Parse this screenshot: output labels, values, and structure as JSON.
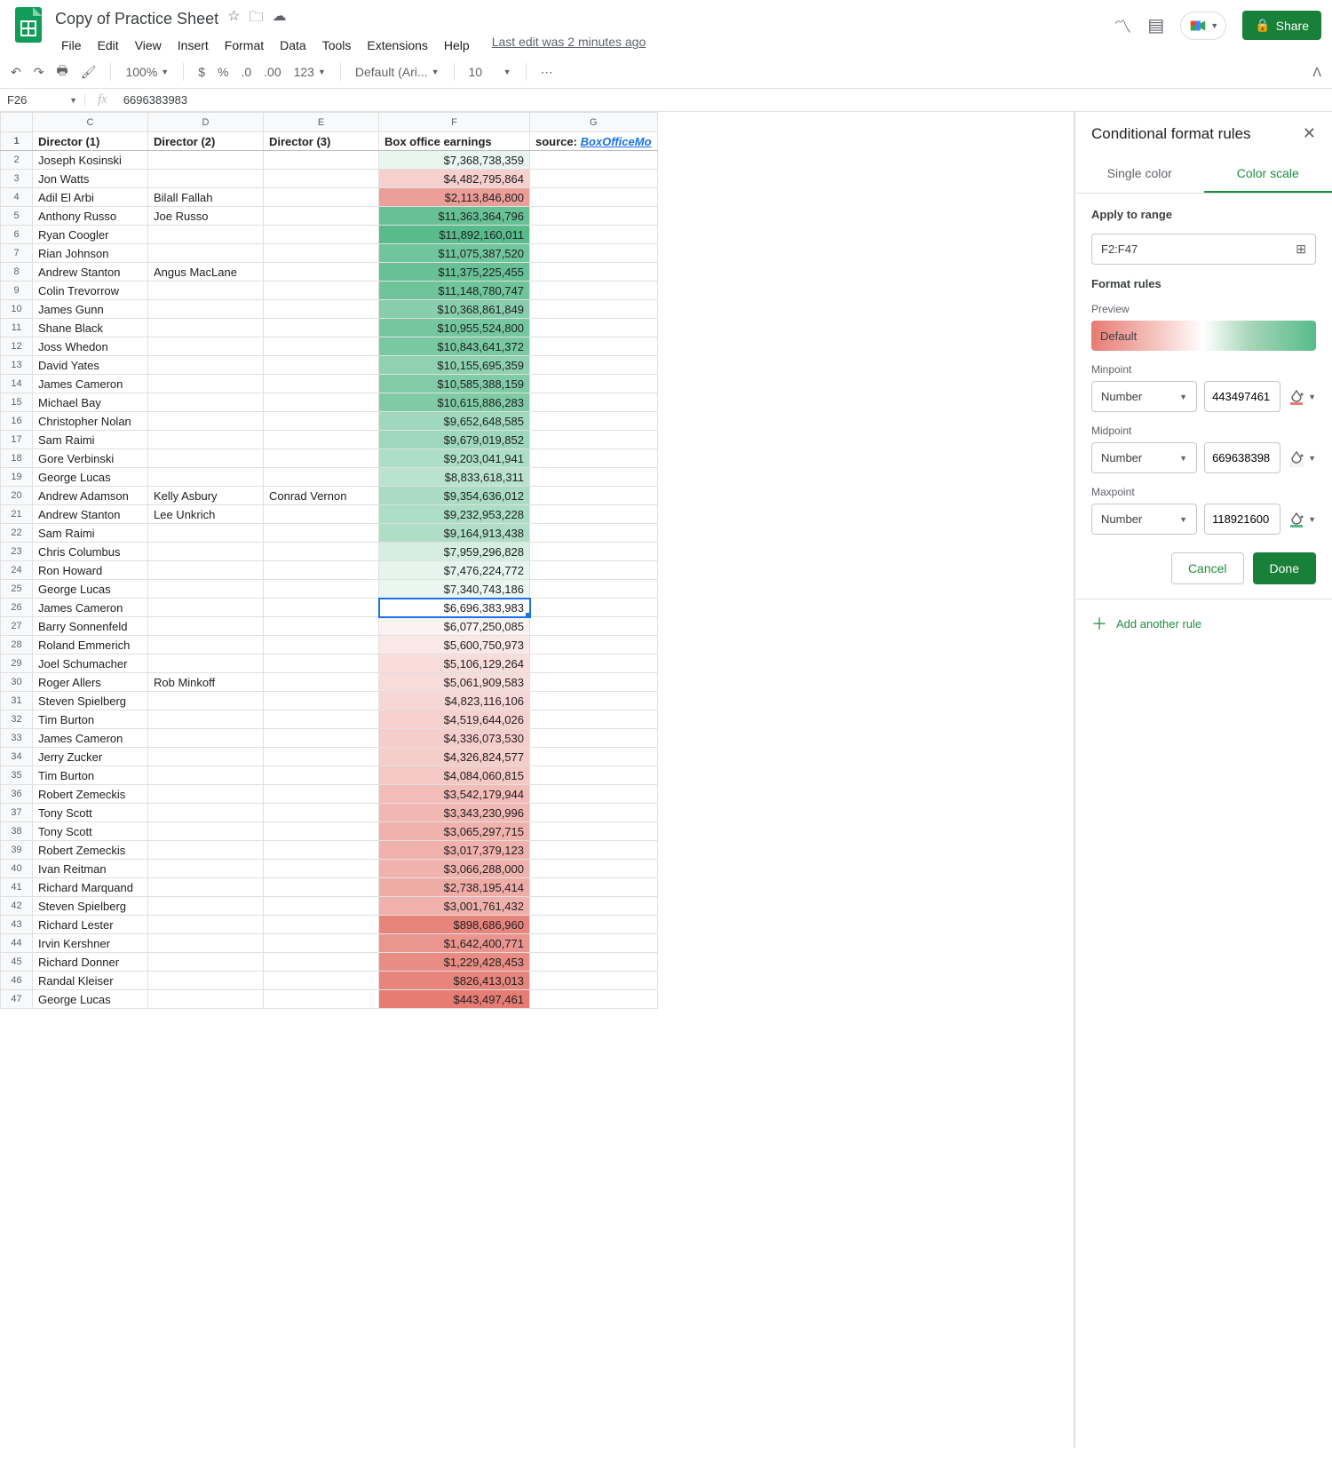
{
  "app": {
    "title": "Copy of Practice Sheet",
    "last_edit": "Last edit was 2 minutes ago",
    "share": "Share"
  },
  "menu": [
    "File",
    "Edit",
    "View",
    "Insert",
    "Format",
    "Data",
    "Tools",
    "Extensions",
    "Help"
  ],
  "toolbar": {
    "zoom": "100%",
    "font": "Default (Ari...",
    "size": "10",
    "num_format": "123"
  },
  "formula_bar": {
    "cell_ref": "F26",
    "value": "6696383983"
  },
  "columns": [
    "C",
    "D",
    "E",
    "F",
    "G"
  ],
  "header_row": {
    "c": "Director (1)",
    "d": "Director (2)",
    "e": "Director (3)",
    "f": "Box office earnings",
    "g_label": "source: ",
    "g_link": "BoxOfficeMo"
  },
  "rows": [
    {
      "n": 2,
      "c": "Joseph Kosinski",
      "d": "",
      "e": "",
      "f": "$7,368,738,359",
      "v": 7368738359
    },
    {
      "n": 3,
      "c": "Jon Watts",
      "d": "",
      "e": "",
      "f": "$4,482,795,864",
      "v": 4482795864
    },
    {
      "n": 4,
      "c": "Adil El Arbi",
      "d": "Bilall Fallah",
      "e": "",
      "f": "$2,113,846,800",
      "v": 2113846800
    },
    {
      "n": 5,
      "c": "Anthony Russo",
      "d": "Joe Russo",
      "e": "",
      "f": "$11,363,364,796",
      "v": 11363364796
    },
    {
      "n": 6,
      "c": "Ryan Coogler",
      "d": "",
      "e": "",
      "f": "$11,892,160,011",
      "v": 11892160011
    },
    {
      "n": 7,
      "c": "Rian Johnson",
      "d": "",
      "e": "",
      "f": "$11,075,387,520",
      "v": 11075387520
    },
    {
      "n": 8,
      "c": "Andrew Stanton",
      "d": "Angus MacLane",
      "e": "",
      "f": "$11,375,225,455",
      "v": 11375225455
    },
    {
      "n": 9,
      "c": "Colin Trevorrow",
      "d": "",
      "e": "",
      "f": "$11,148,780,747",
      "v": 11148780747
    },
    {
      "n": 10,
      "c": "James Gunn",
      "d": "",
      "e": "",
      "f": "$10,368,861,849",
      "v": 10368861849
    },
    {
      "n": 11,
      "c": "Shane Black",
      "d": "",
      "e": "",
      "f": "$10,955,524,800",
      "v": 10955524800
    },
    {
      "n": 12,
      "c": "Joss Whedon",
      "d": "",
      "e": "",
      "f": "$10,843,641,372",
      "v": 10843641372
    },
    {
      "n": 13,
      "c": "David Yates",
      "d": "",
      "e": "",
      "f": "$10,155,695,359",
      "v": 10155695359
    },
    {
      "n": 14,
      "c": "James Cameron",
      "d": "",
      "e": "",
      "f": "$10,585,388,159",
      "v": 10585388159
    },
    {
      "n": 15,
      "c": "Michael Bay",
      "d": "",
      "e": "",
      "f": "$10,615,886,283",
      "v": 10615886283
    },
    {
      "n": 16,
      "c": "Christopher Nolan",
      "d": "",
      "e": "",
      "f": "$9,652,648,585",
      "v": 9652648585
    },
    {
      "n": 17,
      "c": "Sam Raimi",
      "d": "",
      "e": "",
      "f": "$9,679,019,852",
      "v": 9679019852
    },
    {
      "n": 18,
      "c": "Gore Verbinski",
      "d": "",
      "e": "",
      "f": "$9,203,041,941",
      "v": 9203041941
    },
    {
      "n": 19,
      "c": "George Lucas",
      "d": "",
      "e": "",
      "f": "$8,833,618,311",
      "v": 8833618311
    },
    {
      "n": 20,
      "c": "Andrew Adamson",
      "d": "Kelly Asbury",
      "e": "Conrad Vernon",
      "f": "$9,354,636,012",
      "v": 9354636012
    },
    {
      "n": 21,
      "c": "Andrew Stanton",
      "d": "Lee Unkrich",
      "e": "",
      "f": "$9,232,953,228",
      "v": 9232953228
    },
    {
      "n": 22,
      "c": "Sam Raimi",
      "d": "",
      "e": "",
      "f": "$9,164,913,438",
      "v": 9164913438
    },
    {
      "n": 23,
      "c": "Chris Columbus",
      "d": "",
      "e": "",
      "f": "$7,959,296,828",
      "v": 7959296828
    },
    {
      "n": 24,
      "c": "Ron Howard",
      "d": "",
      "e": "",
      "f": "$7,476,224,772",
      "v": 7476224772
    },
    {
      "n": 25,
      "c": "George Lucas",
      "d": "",
      "e": "",
      "f": "$7,340,743,186",
      "v": 7340743186
    },
    {
      "n": 26,
      "c": "James Cameron",
      "d": "",
      "e": "",
      "f": "$6,696,383,983",
      "v": 6696383983,
      "selected": true
    },
    {
      "n": 27,
      "c": "Barry Sonnenfeld",
      "d": "",
      "e": "",
      "f": "$6,077,250,085",
      "v": 6077250085
    },
    {
      "n": 28,
      "c": "Roland Emmerich",
      "d": "",
      "e": "",
      "f": "$5,600,750,973",
      "v": 5600750973
    },
    {
      "n": 29,
      "c": "Joel Schumacher",
      "d": "",
      "e": "",
      "f": "$5,106,129,264",
      "v": 5106129264
    },
    {
      "n": 30,
      "c": "Roger Allers",
      "d": "Rob Minkoff",
      "e": "",
      "f": "$5,061,909,583",
      "v": 5061909583
    },
    {
      "n": 31,
      "c": "Steven Spielberg",
      "d": "",
      "e": "",
      "f": "$4,823,116,106",
      "v": 4823116106
    },
    {
      "n": 32,
      "c": "Tim Burton",
      "d": "",
      "e": "",
      "f": "$4,519,644,026",
      "v": 4519644026
    },
    {
      "n": 33,
      "c": "James Cameron",
      "d": "",
      "e": "",
      "f": "$4,336,073,530",
      "v": 4336073530
    },
    {
      "n": 34,
      "c": "Jerry Zucker",
      "d": "",
      "e": "",
      "f": "$4,326,824,577",
      "v": 4326824577
    },
    {
      "n": 35,
      "c": "Tim Burton",
      "d": "",
      "e": "",
      "f": "$4,084,060,815",
      "v": 4084060815
    },
    {
      "n": 36,
      "c": "Robert Zemeckis",
      "d": "",
      "e": "",
      "f": "$3,542,179,944",
      "v": 3542179944
    },
    {
      "n": 37,
      "c": "Tony Scott",
      "d": "",
      "e": "",
      "f": "$3,343,230,996",
      "v": 3343230996
    },
    {
      "n": 38,
      "c": "Tony Scott",
      "d": "",
      "e": "",
      "f": "$3,065,297,715",
      "v": 3065297715
    },
    {
      "n": 39,
      "c": "Robert Zemeckis",
      "d": "",
      "e": "",
      "f": "$3,017,379,123",
      "v": 3017379123
    },
    {
      "n": 40,
      "c": "Ivan Reitman",
      "d": "",
      "e": "",
      "f": "$3,066,288,000",
      "v": 3066288000
    },
    {
      "n": 41,
      "c": "Richard Marquand",
      "d": "",
      "e": "",
      "f": "$2,738,195,414",
      "v": 2738195414
    },
    {
      "n": 42,
      "c": "Steven Spielberg",
      "d": "",
      "e": "",
      "f": "$3,001,761,432",
      "v": 3001761432
    },
    {
      "n": 43,
      "c": "Richard Lester",
      "d": "",
      "e": "",
      "f": "$898,686,960",
      "v": 898686960
    },
    {
      "n": 44,
      "c": "Irvin Kershner",
      "d": "",
      "e": "",
      "f": "$1,642,400,771",
      "v": 1642400771
    },
    {
      "n": 45,
      "c": "Richard Donner",
      "d": "",
      "e": "",
      "f": "$1,229,428,453",
      "v": 1229428453
    },
    {
      "n": 46,
      "c": "Randal Kleiser",
      "d": "",
      "e": "",
      "f": "$826,413,013",
      "v": 826413013
    },
    {
      "n": 47,
      "c": "George Lucas",
      "d": "",
      "e": "",
      "f": "$443,497,461",
      "v": 443497461
    }
  ],
  "color_scale": {
    "min": 443497461,
    "mid": 6696383983,
    "max": 11892160011,
    "min_color": "#e67c73",
    "mid_color": "#ffffff",
    "max_color": "#57bb8a"
  },
  "sidepanel": {
    "title": "Conditional format rules",
    "tabs": {
      "single": "Single color",
      "scale": "Color scale"
    },
    "apply_label": "Apply to range",
    "range": "F2:F47",
    "rules_label": "Format rules",
    "preview_label": "Preview",
    "preview_text": "Default",
    "min_label": "Minpoint",
    "mid_label": "Midpoint",
    "max_label": "Maxpoint",
    "select_type": "Number",
    "min_value": "443497461",
    "mid_value": "669638398",
    "max_value": "118921600",
    "cancel": "Cancel",
    "done": "Done",
    "add_rule": "Add another rule"
  }
}
